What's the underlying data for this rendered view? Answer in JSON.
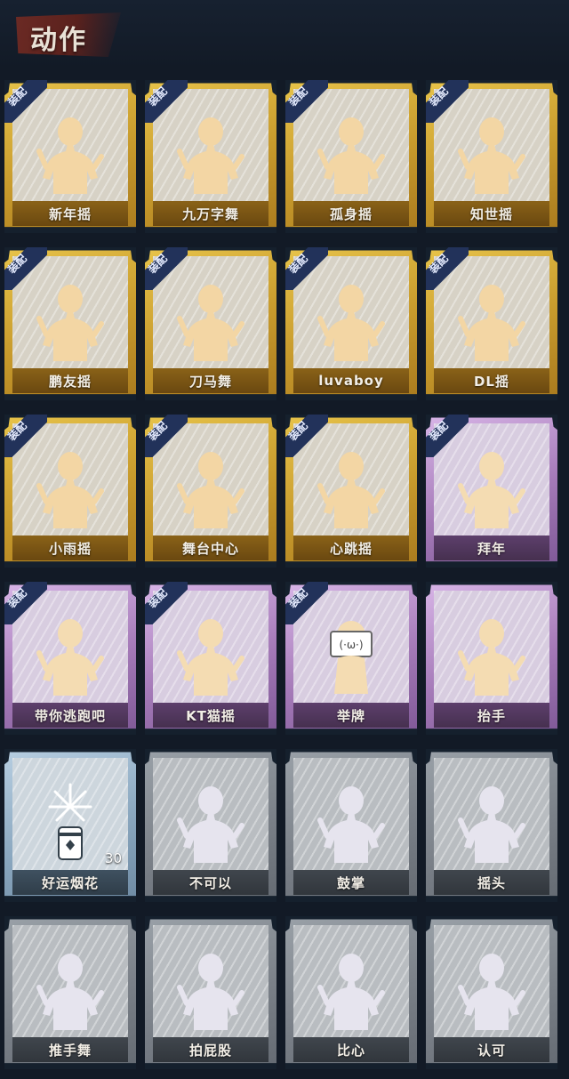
{
  "header": {
    "title": "动作"
  },
  "equip_badge": "装配",
  "cards": [
    {
      "label": "新年摇",
      "rarity": "gold",
      "equipped": true,
      "icon": "dance-pose-icon"
    },
    {
      "label": "九万字舞",
      "rarity": "gold",
      "equipped": true,
      "icon": "dance-pose-icon"
    },
    {
      "label": "孤身摇",
      "rarity": "gold",
      "equipped": true,
      "icon": "dance-pose-icon"
    },
    {
      "label": "知世摇",
      "rarity": "gold",
      "equipped": true,
      "icon": "dance-pose-icon"
    },
    {
      "label": "鹏友摇",
      "rarity": "gold",
      "equipped": true,
      "icon": "dance-pose-icon"
    },
    {
      "label": "刀马舞",
      "rarity": "gold",
      "equipped": true,
      "icon": "dance-pose-icon"
    },
    {
      "label": "luvaboy",
      "rarity": "gold",
      "equipped": true,
      "icon": "dance-pose-icon"
    },
    {
      "label": "DL摇",
      "rarity": "gold",
      "equipped": true,
      "icon": "dance-pose-icon"
    },
    {
      "label": "小雨摇",
      "rarity": "gold",
      "equipped": true,
      "icon": "dance-pose-icon"
    },
    {
      "label": "舞台中心",
      "rarity": "gold",
      "equipped": true,
      "icon": "dance-pose-icon"
    },
    {
      "label": "心跳摇",
      "rarity": "gold",
      "equipped": true,
      "icon": "dance-pose-icon"
    },
    {
      "label": "拜年",
      "rarity": "purple",
      "equipped": true,
      "icon": "bow-pose-icon"
    },
    {
      "label": "带你逃跑吧",
      "rarity": "purple",
      "equipped": true,
      "icon": "dance-pose-icon"
    },
    {
      "label": "KT猫摇",
      "rarity": "purple",
      "equipped": true,
      "icon": "dance-pose-icon"
    },
    {
      "label": "举牌",
      "rarity": "purple",
      "equipped": true,
      "icon": "sign-board-icon"
    },
    {
      "label": "抬手",
      "rarity": "purple",
      "equipped": false,
      "icon": "raise-hand-icon"
    },
    {
      "label": "好运烟花",
      "rarity": "blue",
      "equipped": false,
      "icon": "firework-icon",
      "count": "30"
    },
    {
      "label": "不可以",
      "rarity": "gray",
      "equipped": false,
      "icon": "finger-wag-icon"
    },
    {
      "label": "鼓掌",
      "rarity": "gray",
      "equipped": false,
      "icon": "clap-icon"
    },
    {
      "label": "摇头",
      "rarity": "gray",
      "equipped": false,
      "icon": "head-shake-icon"
    },
    {
      "label": "推手舞",
      "rarity": "gray",
      "equipped": false,
      "icon": "push-hands-icon"
    },
    {
      "label": "拍屁股",
      "rarity": "gray",
      "equipped": false,
      "icon": "butt-slap-icon"
    },
    {
      "label": "比心",
      "rarity": "gray",
      "equipped": false,
      "icon": "finger-heart-icon"
    },
    {
      "label": "认可",
      "rarity": "gray",
      "equipped": false,
      "icon": "thumbs-up-icon"
    }
  ],
  "colors": {
    "gold_figure": "#f3d6a4",
    "purple_figure": "#f4dcb2",
    "faded_figure": "#e6e4ee"
  }
}
